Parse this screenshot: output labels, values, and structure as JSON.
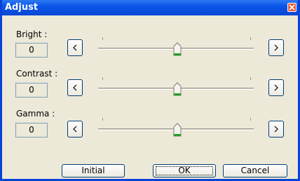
{
  "window": {
    "title": "Adjust"
  },
  "rows": [
    {
      "label": "Bright :",
      "value": "0",
      "level": 0.5
    },
    {
      "label": "Contrast :",
      "value": "0",
      "level": 0.5
    },
    {
      "label": "Gamma :",
      "value": "0",
      "level": 0.5
    }
  ],
  "buttons": {
    "initial": "Initial",
    "ok": "OK",
    "cancel": "Cancel"
  },
  "icons": {
    "close": "close-icon",
    "decrease": "chevron-left-icon",
    "increase": "chevron-right-icon",
    "thumb": "slider-thumb-icon"
  },
  "colors": {
    "titlebar": "#0a55e8",
    "dialog": "#ece9d8",
    "thumb_accent": "#21a121"
  }
}
